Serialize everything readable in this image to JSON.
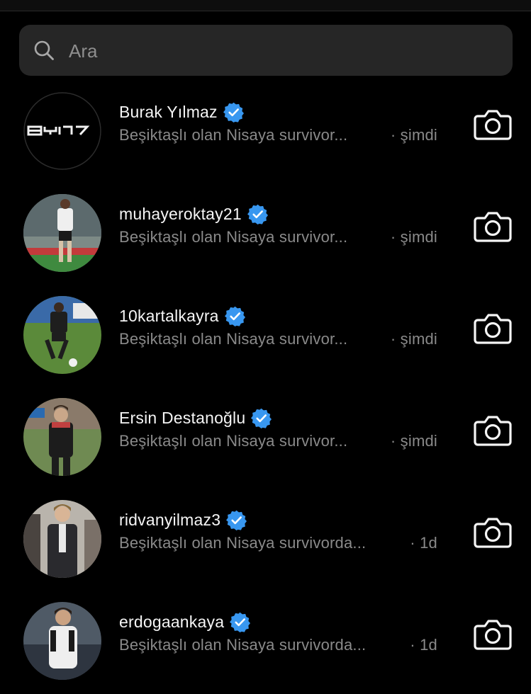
{
  "search": {
    "placeholder": "Ara",
    "icon": "search-icon"
  },
  "colors": {
    "background": "#000000",
    "search_bg": "#262626",
    "verified_badge": "#3897f0",
    "primary_text": "#f5f5f5",
    "secondary_text": "#8a8a8a"
  },
  "conversations": [
    {
      "username": "Burak Yılmaz",
      "verified": true,
      "preview": "Beşiktaşlı olan Nisaya survivor...",
      "time": "· şimdi",
      "action_icon": "camera-icon"
    },
    {
      "username": "muhayeroktay21",
      "verified": true,
      "preview": "Beşiktaşlı olan Nisaya survivor...",
      "time": "· şimdi",
      "action_icon": "camera-icon"
    },
    {
      "username": "10kartalkayra",
      "verified": true,
      "preview": "Beşiktaşlı olan Nisaya survivor...",
      "time": "· şimdi",
      "action_icon": "camera-icon"
    },
    {
      "username": "Ersin Destanoğlu",
      "verified": true,
      "preview": "Beşiktaşlı olan Nisaya survivor...",
      "time": "· şimdi",
      "action_icon": "camera-icon"
    },
    {
      "username": "ridvanyilmaz3",
      "verified": true,
      "preview": "Beşiktaşlı olan Nisaya survivorda...",
      "time": "· 1d",
      "action_icon": "camera-icon"
    },
    {
      "username": "erdogaankaya",
      "verified": true,
      "preview": "Beşiktaşlı olan Nisaya survivorda...",
      "time": "· 1d",
      "action_icon": "camera-icon"
    }
  ]
}
